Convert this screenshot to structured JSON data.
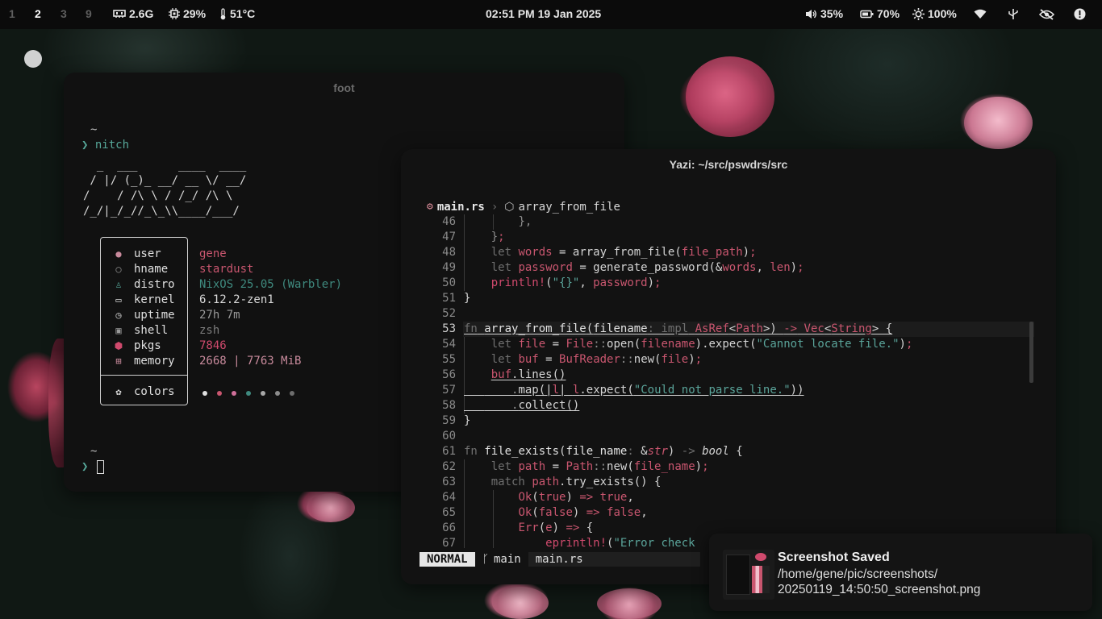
{
  "topbar": {
    "workspaces": [
      {
        "label": "1",
        "state": "dim"
      },
      {
        "label": "2",
        "state": "active"
      },
      {
        "label": "3",
        "state": "dim"
      },
      {
        "label": "9",
        "state": "dim"
      }
    ],
    "ram": "2.6G",
    "cpu": "29%",
    "temp": "51°C",
    "clock": "02:51 PM 19 Jan 2025",
    "volume": "35%",
    "battery": "70%",
    "brightness": "100%",
    "icons": [
      "memory-icon",
      "cpu-icon",
      "thermometer-icon",
      "volume-icon",
      "battery-icon",
      "brightness-icon",
      "wifi-icon",
      "usb-icon",
      "eye-off-icon",
      "alert-icon"
    ]
  },
  "foot": {
    "title": "foot",
    "tilde_1": "~",
    "command": "nitch",
    "ascii_art": [
      "  _  ___      ____  ____",
      " / |/ (_)_ __/ __ \\/ __/",
      "/    / /\\ \\ / /_/ /\\ \\",
      "/_/|_/_//_\\_\\\\____/___/"
    ],
    "info": [
      {
        "key": "user",
        "value": "gene",
        "icon": "user-icon"
      },
      {
        "key": "hname",
        "value": "stardust",
        "icon": "host-icon"
      },
      {
        "key": "distro",
        "value": "NixOS 25.05 (Warbler)",
        "icon": "linux-icon"
      },
      {
        "key": "kernel",
        "value": "6.12.2-zen1",
        "icon": "laptop-icon"
      },
      {
        "key": "uptime",
        "value": "27h 7m",
        "icon": "clock-icon"
      },
      {
        "key": "shell",
        "value": "zsh",
        "icon": "terminal-icon"
      },
      {
        "key": "pkgs",
        "value": "7846",
        "icon": "package-icon"
      },
      {
        "key": "memory",
        "value": "2668 | 7763 MiB",
        "icon": "memory-chip-icon"
      }
    ],
    "colors_label": "colors",
    "color_dots": [
      "#e0e0e0",
      "#c9566f",
      "#d0709a",
      "#3f8a7f",
      "#a8a8a8",
      "#8c8c8c",
      "#6d6d6d"
    ],
    "tilde_2": "~"
  },
  "yazi": {
    "title": "Yazi: ~/src/pswdrs/src",
    "breadcrumb_file": "main.rs",
    "breadcrumb_symbol": "array_from_file",
    "mode": "NORMAL",
    "branch": "main",
    "status_file": "main.rs"
  },
  "notification": {
    "title": "Screenshot Saved",
    "path_line_1": "/home/gene/pic/screenshots/",
    "path_line_2": "20250119_14:50:50_screenshot.png"
  },
  "colors": {
    "accent_teal": "#57a89a",
    "accent_pink": "#c9566f",
    "bar_bg": "#0b0b0b",
    "window_bg": "#111111"
  }
}
